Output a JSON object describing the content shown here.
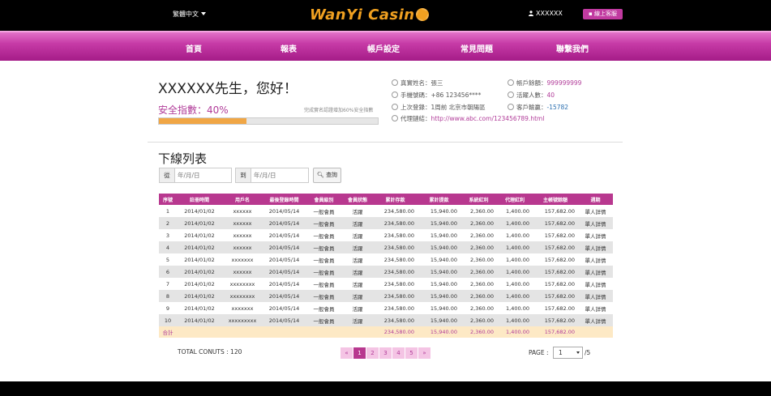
{
  "header": {
    "language": "繁體中文",
    "logo_text": "WanYi Casin",
    "username": "XXXXXX",
    "customer_service": "線上客服"
  },
  "nav": [
    "首頁",
    "報表",
    "帳戶設定",
    "常見問題",
    "聯繫我們"
  ],
  "greeting": "XXXXXX先生，您好！",
  "safety": {
    "label": "安全指數：40%",
    "hint": "完成實名認證增加60%安全指數",
    "level_percent": 40
  },
  "account_info": [
    {
      "label": "真實姓名：",
      "value": "張三",
      "col": "left"
    },
    {
      "label": "手機號碼：",
      "value": "+86 123456****",
      "col": "left"
    },
    {
      "label": "上次登錄：",
      "value": "1周前 北京市朝陽區",
      "col": "left"
    },
    {
      "label": "代理鏈結：",
      "value": "http://www.abc.com/123456789.html",
      "col": "left"
    },
    {
      "label": "帳戶餘額：",
      "value": "999999999",
      "col": "right"
    },
    {
      "label": "活躍人數：",
      "value": "40",
      "col": "right"
    },
    {
      "label": "客戶輸贏：",
      "value": "-15782",
      "col": "right"
    }
  ],
  "downline": {
    "title": "下線列表",
    "from_label": "從",
    "to_label": "到",
    "date_placeholder": "年/月/日",
    "search_label": "查詢"
  },
  "table": {
    "headers": [
      "序號",
      "註冊時間",
      "用戶名",
      "最後登錄時間",
      "會員級別",
      "會員狀態",
      "累計存款",
      "累計提款",
      "系統紅利",
      "代理紅利",
      "主帳號餘額",
      "週期"
    ],
    "rows": [
      [
        "1",
        "2014/01/02",
        "xxxxxx",
        "2014/05/14",
        "一般會員",
        "活躍",
        "234,580.00",
        "15,940.00",
        "2,360.00",
        "1,400.00",
        "157,682.00",
        "單人詳情"
      ],
      [
        "2",
        "2014/01/02",
        "xxxxxx",
        "2014/05/14",
        "一般會員",
        "活躍",
        "234,580.00",
        "15,940.00",
        "2,360.00",
        "1,400.00",
        "157,682.00",
        "單人詳情"
      ],
      [
        "3",
        "2014/01/02",
        "xxxxxx",
        "2014/05/14",
        "一般會員",
        "活躍",
        "234,580.00",
        "15,940.00",
        "2,360.00",
        "1,400.00",
        "157,682.00",
        "單人詳情"
      ],
      [
        "4",
        "2014/01/02",
        "xxxxxx",
        "2014/05/14",
        "一般會員",
        "活躍",
        "234,580.00",
        "15,940.00",
        "2,360.00",
        "1,400.00",
        "157,682.00",
        "單人詳情"
      ],
      [
        "5",
        "2014/01/02",
        "xxxxxxx",
        "2014/05/14",
        "一般會員",
        "活躍",
        "234,580.00",
        "15,940.00",
        "2,360.00",
        "1,400.00",
        "157,682.00",
        "單人詳情"
      ],
      [
        "6",
        "2014/01/02",
        "xxxxxx",
        "2014/05/14",
        "一般會員",
        "活躍",
        "234,580.00",
        "15,940.00",
        "2,360.00",
        "1,400.00",
        "157,682.00",
        "單人詳情"
      ],
      [
        "7",
        "2014/01/02",
        "xxxxxxxx",
        "2014/05/14",
        "一般會員",
        "活躍",
        "234,580.00",
        "15,940.00",
        "2,360.00",
        "1,400.00",
        "157,682.00",
        "單人詳情"
      ],
      [
        "8",
        "2014/01/02",
        "xxxxxxxx",
        "2014/05/14",
        "一般會員",
        "活躍",
        "234,580.00",
        "15,940.00",
        "2,360.00",
        "1,400.00",
        "157,682.00",
        "單人詳情"
      ],
      [
        "9",
        "2014/01/02",
        "xxxxxxx",
        "2014/05/14",
        "一般會員",
        "活躍",
        "234,580.00",
        "15,940.00",
        "2,360.00",
        "1,400.00",
        "157,682.00",
        "單人詳情"
      ],
      [
        "10",
        "2014/01/02",
        "xxxxxxxxx",
        "2014/05/14",
        "一般會員",
        "活躍",
        "234,580.00",
        "15,940.00",
        "2,360.00",
        "1,400.00",
        "157,682.00",
        "單人詳情"
      ]
    ],
    "total_row": [
      "合計",
      "",
      "",
      "",
      "",
      "",
      "234,580.00",
      "15,940.00",
      "2,360.00",
      "1,400.00",
      "157,682.00",
      ""
    ]
  },
  "footer": {
    "total_count": "TOTAL CONUTS : 120",
    "pages": [
      "«",
      "1",
      "2",
      "3",
      "4",
      "5",
      "»"
    ],
    "active_page": "1",
    "page_label": "PAGE :",
    "page_select": "1",
    "page_total": "/5"
  },
  "colors": {
    "brand_magenta": "#b8388f",
    "logo_gold": "#f0a020",
    "progress_orange": "#f0a645"
  }
}
